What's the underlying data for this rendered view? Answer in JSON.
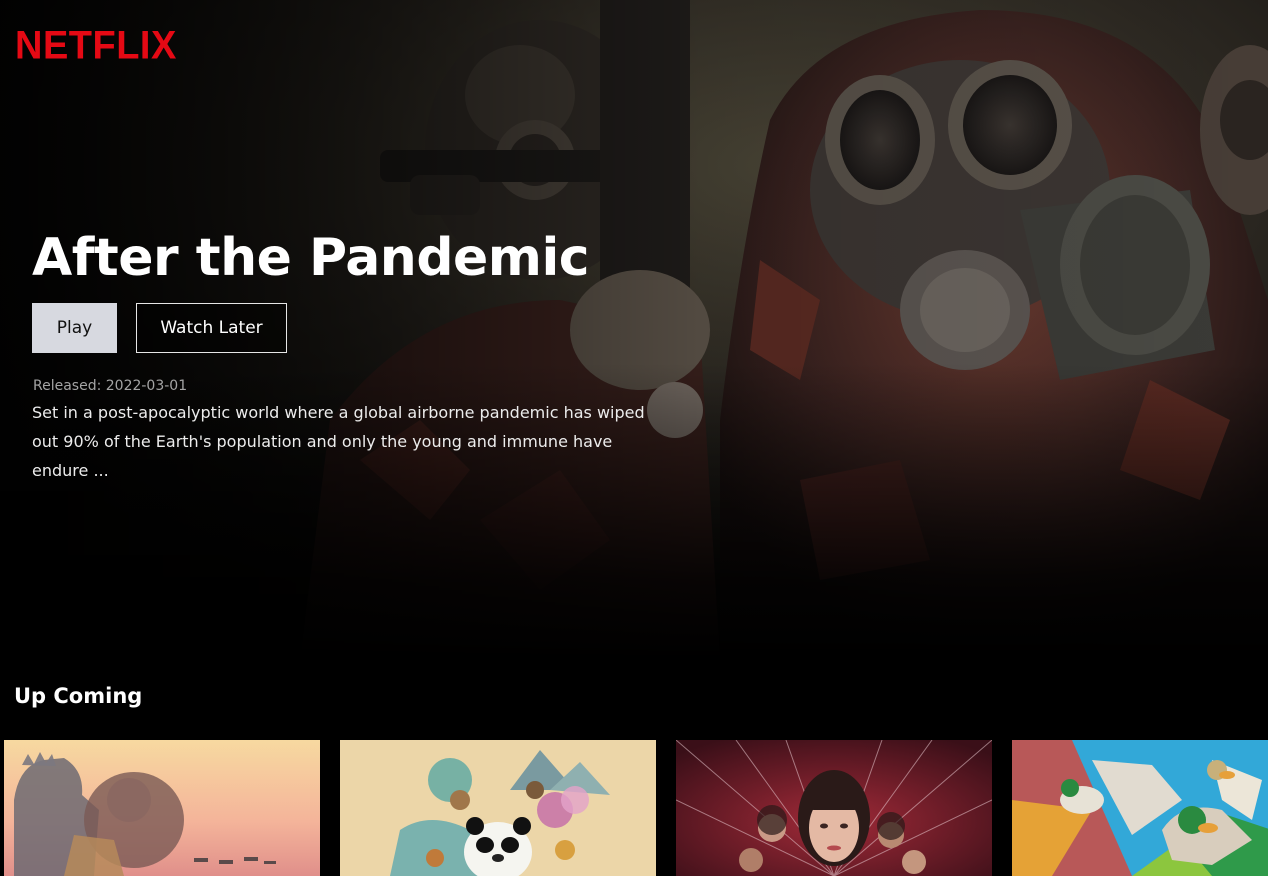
{
  "brand": {
    "logo_text": "NETFLIX",
    "logo_color": "#e50914"
  },
  "hero": {
    "title": "After the Pandemic",
    "play_label": "Play",
    "watch_later_label": "Watch Later",
    "released": "Released: 2022-03-01",
    "overview": "Set in a post-apocalyptic world where a global airborne pandemic has wiped out 90% of the Earth's population and only the young and immune have endure ..."
  },
  "upcoming": {
    "title": "Up Coming",
    "items": [
      {
        "poster_icon": "godzilla-kong-poster"
      },
      {
        "poster_icon": "kung-fu-panda-poster"
      },
      {
        "poster_icon": "madame-web-poster"
      },
      {
        "poster_icon": "migration-ducks-poster"
      }
    ]
  }
}
